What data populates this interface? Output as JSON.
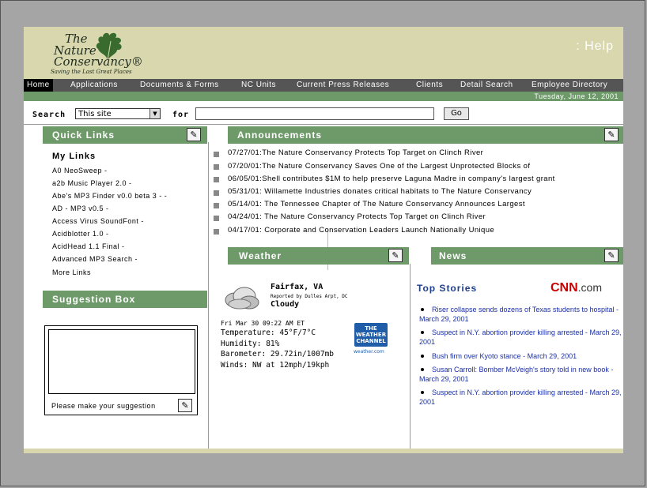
{
  "logo": {
    "line1": "The",
    "line2": "Nature",
    "line3": "Conservancy®",
    "tagline": "Saving the Last Great Places"
  },
  "header": {
    "help": ": Help"
  },
  "nav": {
    "items": [
      "Home",
      "Applications",
      "Documents & Forms",
      "NC Units",
      "Current Press Releases",
      "Clients",
      "Detail Search",
      "Employee Directory"
    ]
  },
  "date": "Tuesday, June 12, 2001",
  "search": {
    "label": "Search",
    "scope": "This site",
    "for": "for",
    "go": "Go",
    "query": ""
  },
  "quick_links": {
    "title": "Quick Links",
    "heading": "My Links",
    "items": [
      "A0 NeoSweep -",
      "a2b Music Player 2.0 -",
      "Abe's MP3 Finder v0.0 beta 3 - -",
      "AD - MP3 v0.5 -",
      "Access Virus SoundFont -",
      "Acidblotter 1.0 -",
      "AcidHead 1.1 Final -",
      "Advanced MP3 Search -",
      "More Links"
    ]
  },
  "suggestion": {
    "title": "Suggestion Box",
    "prompt": "Please make your suggestion"
  },
  "announcements": {
    "title": "Announcements",
    "items": [
      "07/27/01:The Nature Conservancy Protects Top Target on Clinch River",
      "07/20/01:The Nature Conservancy Saves One of the Largest Unprotected Blocks of",
      "06/05/01:Shell contributes $1M to help preserve Laguna Madre in company's largest grant",
      "05/31/01: Willamette Industries donates critical habitats to The Nature Conservancy",
      "05/14/01: The Tennessee Chapter of The Nature Conservancy Announces Largest",
      "04/24/01: The Nature Conservancy Protects Top Target on Clinch River",
      "04/17/01: Corporate and Conservation Leaders Launch Nationally Unique"
    ]
  },
  "weather": {
    "title": "Weather",
    "city": "Fairfax, VA",
    "reported": "Reported by Dulles Arpt, DC",
    "condition": "Cloudy",
    "time": "Fri Mar 30 09:22 AM ET",
    "temperature": "Temperature: 45°F/7°C",
    "humidity": "Humidity: 81%",
    "barometer": "Barometer: 29.72in/1007mb",
    "winds": "Winds: NW at 12mph/19kph",
    "twc_logo": "THE WEATHER CHANNEL",
    "twc_url": "weather.com"
  },
  "news": {
    "title": "News",
    "top_stories": "Top Stories",
    "cnn": "CNN",
    "cnn_suffix": ".com",
    "items": [
      {
        "title": "Riser collapse sends dozens of Texas students to hospital",
        "date": "- March 29, 2001"
      },
      {
        "title": "Suspect in N.Y. abortion provider killing arrested -",
        "date": "March 29, 2001"
      },
      {
        "title": "Bush firm over Kyoto stance",
        "date": "- March 29, 2001"
      },
      {
        "title": "Susan Carroll: Bomber McVeigh's story told in new book",
        "date": "- March 29, 2001"
      },
      {
        "title": "Suspect in N.Y. abortion provider killing arrested -",
        "date": "March 29, 2001"
      }
    ]
  },
  "icons": {
    "edit": "pencil-icon",
    "weather": "cloud-icon",
    "leaf": "oak-leaf-icon"
  }
}
